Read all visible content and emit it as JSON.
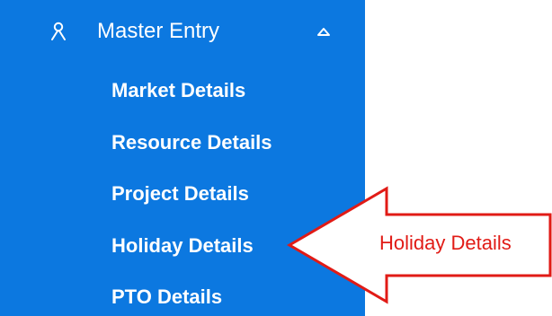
{
  "menu": {
    "header": {
      "label": "Master Entry",
      "icon": "person-icon",
      "expanded_icon": "caret-up-icon"
    },
    "items": [
      {
        "label": "Market Details"
      },
      {
        "label": "Resource Details"
      },
      {
        "label": "Project Details"
      },
      {
        "label": "Holiday Details"
      },
      {
        "label": "PTO Details"
      }
    ]
  },
  "annotation": {
    "label": "Holiday Details",
    "color": "#e11b16"
  },
  "colors": {
    "sidebar_background": "#0c78e0",
    "menu_text": "#ffffff",
    "annotation": "#e11b16"
  }
}
